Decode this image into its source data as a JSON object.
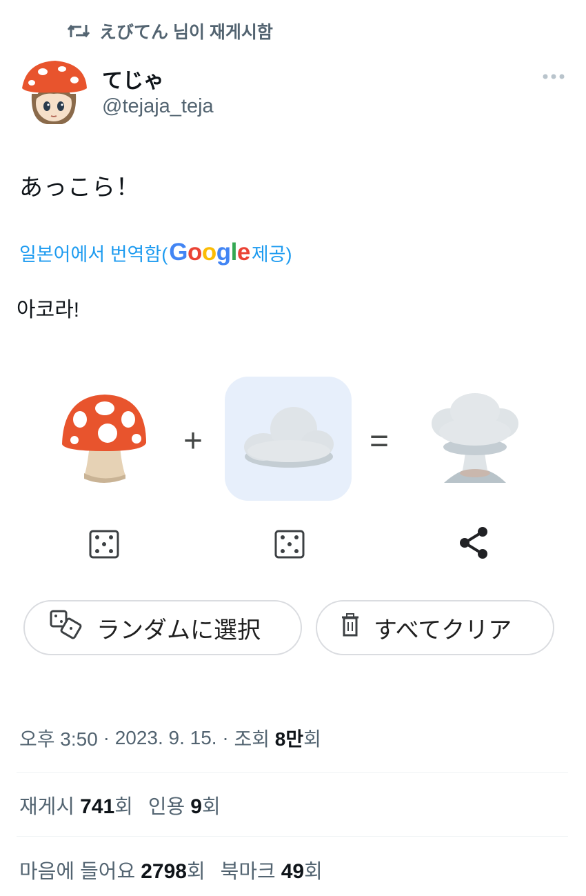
{
  "retweet": {
    "icon": "retweet-icon",
    "label": "えびてん 님이 재게시함"
  },
  "author": {
    "name": "てじゃ",
    "handle": "@tejaja_teja",
    "avatar": "mushroom-girl-avatar"
  },
  "tweet": {
    "text": "あっこら！",
    "translate_label": "일본어에서 번역함(",
    "translate_provider": "Google",
    "translate_suffix": " 제공)",
    "translated_text": "아코라!"
  },
  "mix": {
    "plus": "+",
    "equals": "=",
    "left_emoji": "mushroom",
    "middle_emoji": "cloud",
    "result_emoji": "mushroom-cloud",
    "random_button": "ランダムに選択",
    "clear_button": "すべてクリア"
  },
  "meta": {
    "time": "오후 3:50",
    "sep": " · ",
    "date": "2023. 9. 15.",
    "views_label": "조회 ",
    "views_value": "8만",
    "views_suffix": "회"
  },
  "stats": {
    "retweets_label": "재게시 ",
    "retweets_value": "741",
    "retweets_suffix": "회",
    "quotes_label": "인용 ",
    "quotes_value": "9",
    "quotes_suffix": "회",
    "likes_label": "마음에 들어요 ",
    "likes_value": "2798",
    "likes_suffix": "회",
    "bookmarks_label": "북마크 ",
    "bookmarks_value": "49",
    "bookmarks_suffix": "회"
  },
  "colors": {
    "accent": "#1d9bf0",
    "muted": "#536471",
    "tile": "#e7effb",
    "mushroom_red": "#e8542d"
  }
}
